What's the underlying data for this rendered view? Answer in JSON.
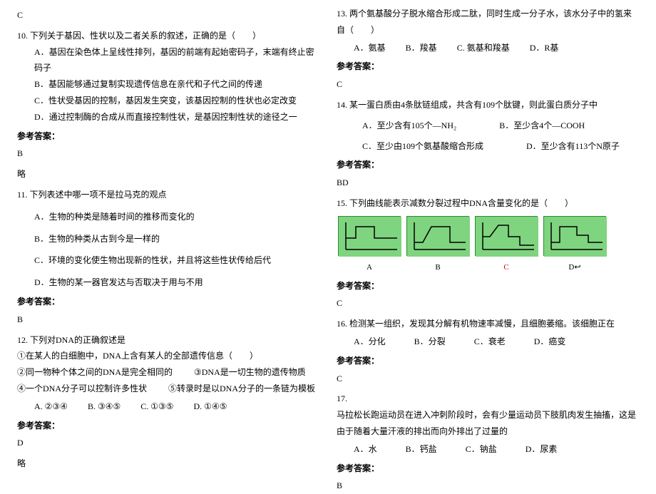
{
  "left": {
    "prev_ans": "C",
    "q10": {
      "stem": "10. 下列关于基因、性状以及二者关系的叙述，正确的是（　　）",
      "A": "A．基因在染色体上呈线性排列，基因的前端有起始密码子，末端有终止密码子",
      "B": "B．基因能够通过复制实现遗传信息在亲代和子代之间的传递",
      "C": "C．性状受基因的控制，基因发生突变，该基因控制的性状也必定改变",
      "D": "D．通过控制酶的合成从而直接控制性状，是基因控制性状的途径之一",
      "ans_label": "参考答案：",
      "ans": "B",
      "note": "略"
    },
    "q11": {
      "stem": "11. 下列表述中哪一项不是拉马克的观点",
      "A": "A．生物的种类是随着时间的推移而变化的",
      "B": "B．生物的种类从古到今是一样的",
      "C": "C．环境的变化使生物出现新的性状，并且将这些性状传给后代",
      "D": "D．生物的某一器官发达与否取决于用与不用",
      "ans_label": "参考答案：",
      "ans": "B"
    },
    "q12": {
      "stem": "12. 下列对DNA的正确叙述是",
      "line1": "①在某人的白细胞中，DNA上含有某人的全部遗传信息（　　）",
      "line2a": "②同一物种个体之间的DNA是完全相同的",
      "line2b": "③DNA是一切生物的遗传物质",
      "line3a": "④一个DNA分子可以控制许多性状",
      "line3b": "⑤转录时是以DNA分子的一条链为模板",
      "optsA": "A. ②③④",
      "optsB": "B. ③④⑤",
      "optsC": "C. ①③⑤",
      "optsD": "D. ①④⑤",
      "ans_label": "参考答案：",
      "ans": "D",
      "note": "略"
    }
  },
  "right": {
    "q13": {
      "stem": "13. 两个氨基酸分子脱水缩合形成二肽，同时生成一分子水，该水分子中的氢来自（　　）",
      "optA": "A．氨基",
      "optB": "B．羧基",
      "optC": "C. 氨基和羧基",
      "optD": "D．R基",
      "ans_label": "参考答案：",
      "ans": "C"
    },
    "q14": {
      "stem": "14. 某一蛋白质由4条肽链组成，共含有109个肽键，则此蛋白质分子中",
      "optA": "A．至少含有105个—NH₂",
      "optB": "B．至少含4个—COOH",
      "optC": "C．至少由109个氨基酸缩合形成",
      "optD": "D．至少含有113个N原子",
      "ans_label": "参考答案：",
      "ans": "BD"
    },
    "q15": {
      "stem": "15. 下列曲线能表示减数分裂过程中DNA含量变化的是（　　）",
      "labelA": "A",
      "labelB": "B",
      "labelC": "C",
      "labelD": "D↩",
      "ans_label": "参考答案：",
      "ans": "C"
    },
    "q16": {
      "stem": "16. 检测某一组织，发现其分解有机物速率减慢，且细胞萎缩。该细胞正在",
      "optA": "A．分化",
      "optB": "B．分裂",
      "optC": "C．衰老",
      "optD": "D．癌变",
      "ans_label": "参考答案：",
      "ans": "C"
    },
    "q17": {
      "num": "17.",
      "stem": "马拉松长跑运动员在进入冲刺阶段时，会有少量运动员下肢肌肉发生抽搐，这是由于随着大量汗液的排出而向外排出了过量的",
      "optA": "A．水",
      "optB": "B．钙盐",
      "optC": "C．钠盐",
      "optD": "D．尿素",
      "ans_label": "参考答案：",
      "ans": "B"
    }
  }
}
